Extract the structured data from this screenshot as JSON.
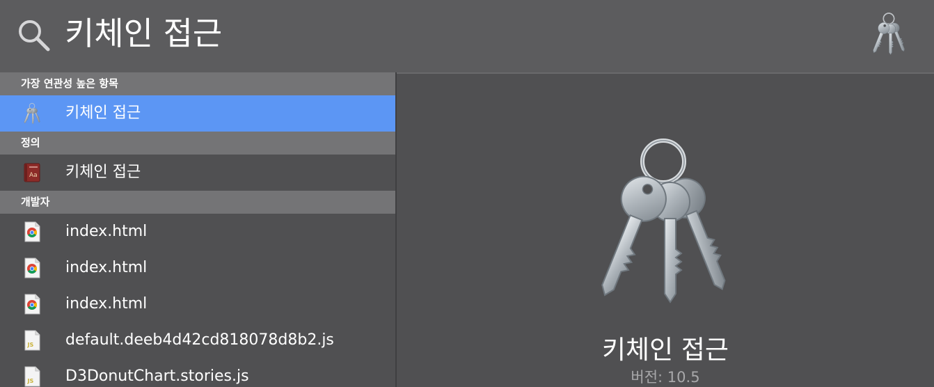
{
  "search": {
    "query": "키체인 접근",
    "icon": "search-icon",
    "app_icon": "keychain-icon"
  },
  "results": {
    "sections": [
      {
        "header": "가장 연관성 높은 항목",
        "items": [
          {
            "label": "키체인 접근",
            "icon": "keychain-icon",
            "selected": true
          }
        ]
      },
      {
        "header": "정의",
        "items": [
          {
            "label": "키체인 접근",
            "icon": "dictionary-icon",
            "selected": false
          }
        ]
      },
      {
        "header": "개발자",
        "items": [
          {
            "label": "index.html",
            "icon": "chrome-document-icon",
            "selected": false
          },
          {
            "label": "index.html",
            "icon": "chrome-document-icon",
            "selected": false
          },
          {
            "label": "index.html",
            "icon": "chrome-document-icon",
            "selected": false
          },
          {
            "label": "default.deeb4d42cd818078d8b2.js",
            "icon": "js-file-icon",
            "selected": false
          },
          {
            "label": "D3DonutChart.stories.js",
            "icon": "js-file-icon",
            "selected": false
          }
        ]
      }
    ]
  },
  "preview": {
    "title": "키체인 접근",
    "version": "버전: 10.5",
    "icon": "keychain-icon"
  },
  "colors": {
    "selected_row": "#5c96f4",
    "section_header": "#747476",
    "background": "#505052"
  }
}
